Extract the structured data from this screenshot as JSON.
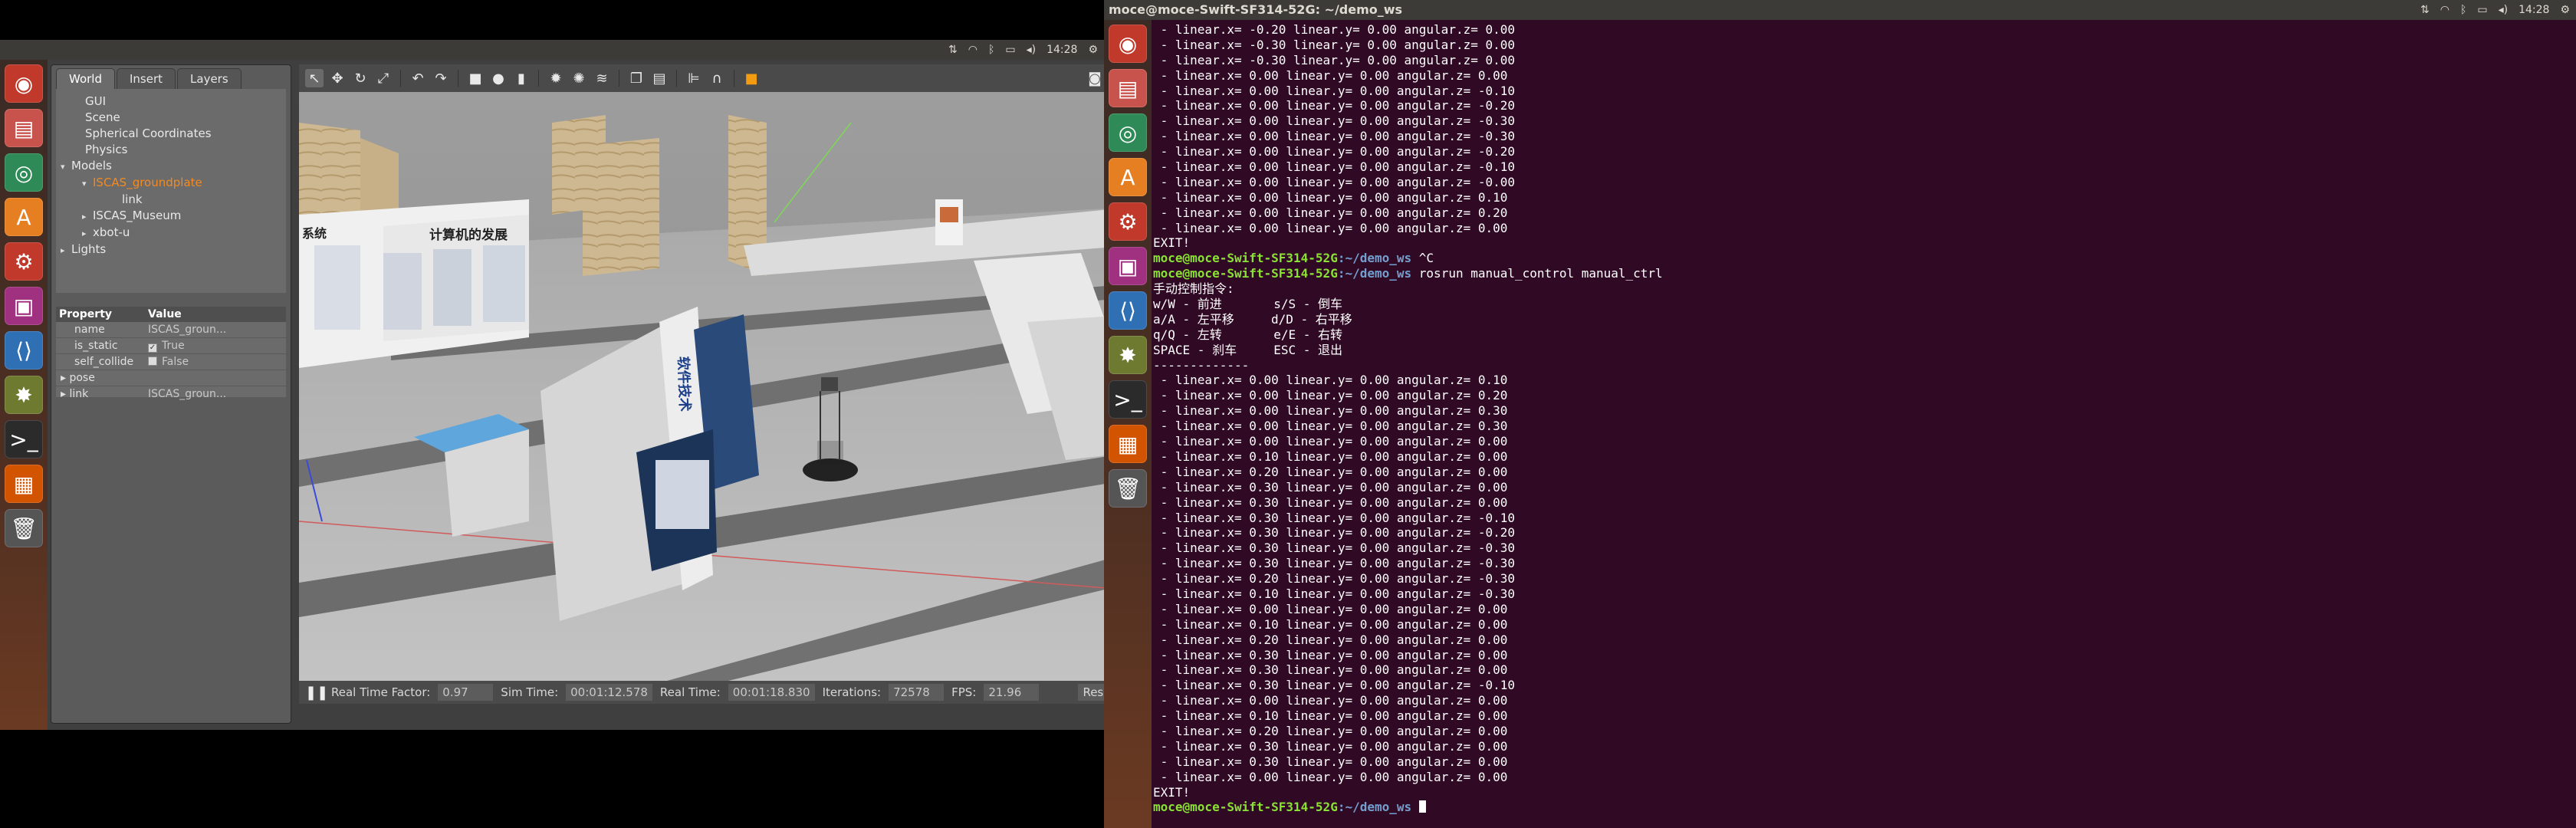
{
  "left": {
    "topbar": {
      "clock": "14:28"
    },
    "launcher": [
      {
        "name": "dash-icon",
        "glyph": "◉",
        "color": "#c0392b"
      },
      {
        "name": "files-icon",
        "glyph": "▤",
        "color": "#c8524c"
      },
      {
        "name": "chrome-icon",
        "glyph": "◎",
        "color": "#2e8b57"
      },
      {
        "name": "software-center-icon",
        "glyph": "A",
        "color": "#e67e22"
      },
      {
        "name": "settings-icon",
        "glyph": "⚙",
        "color": "#c0392b"
      },
      {
        "name": "media-icon",
        "glyph": "▣",
        "color": "#a03080"
      },
      {
        "name": "vscode-icon",
        "glyph": "⟨⟩",
        "color": "#2f6fb3"
      },
      {
        "name": "gazebo-icon",
        "glyph": "✸",
        "color": "#6e7a2f"
      },
      {
        "name": "terminal-icon",
        "glyph": ">_",
        "color": "#2b2b2b"
      },
      {
        "name": "package-icon",
        "glyph": "▦",
        "color": "#d35400"
      },
      {
        "name": "trash-icon",
        "glyph": "🗑",
        "color": "#555555"
      }
    ],
    "gazebo": {
      "tabs": [
        "World",
        "Insert",
        "Layers"
      ],
      "tree": [
        {
          "label": "GUI",
          "level": 1,
          "arrow": ""
        },
        {
          "label": "Scene",
          "level": 1,
          "arrow": ""
        },
        {
          "label": "Spherical Coordinates",
          "level": 1,
          "arrow": ""
        },
        {
          "label": "Physics",
          "level": 1,
          "arrow": ""
        },
        {
          "label": "Models",
          "level": 0,
          "arrow": "▾"
        },
        {
          "label": "ISCAS_groundplate",
          "level": 2,
          "arrow": "▾",
          "selected": true
        },
        {
          "label": "link",
          "level": 3,
          "arrow": ""
        },
        {
          "label": "ISCAS_Museum",
          "level": 2,
          "arrow": "▸"
        },
        {
          "label": "xbot-u",
          "level": 2,
          "arrow": "▸"
        },
        {
          "label": "Lights",
          "level": 0,
          "arrow": "▸"
        }
      ],
      "props_header": {
        "col1": "Property",
        "col2": "Value"
      },
      "props": [
        {
          "name": "name",
          "value": "ISCAS_groun...",
          "checkbox": false,
          "arrow": ""
        },
        {
          "name": "is_static",
          "value": "True",
          "checkbox": true,
          "checked": true,
          "arrow": ""
        },
        {
          "name": "self_collide",
          "value": "False",
          "checkbox": true,
          "checked": false,
          "arrow": ""
        },
        {
          "name": "pose",
          "value": "",
          "checkbox": false,
          "arrow": "▸"
        },
        {
          "name": "link",
          "value": "ISCAS_groun...",
          "checkbox": false,
          "arrow": "▸"
        }
      ],
      "bottombar": {
        "rtf_label": "Real Time Factor:",
        "rtf_value": "0.97",
        "sim_label": "Sim Time:",
        "sim_value": "00:01:12.578",
        "real_label": "Real Time:",
        "real_value": "00:01:18.830",
        "iter_label": "Iterations:",
        "iter_value": "72578",
        "fps_label": "FPS:",
        "fps_value": "21.96",
        "reset_label": "Reset Ti"
      },
      "scene": {
        "sign_left": "系统",
        "sign_mid": "计算机的发展",
        "sign_stand": "软件技术"
      }
    }
  },
  "right": {
    "title": "moce@moce-Swift-SF314-52G: ~/demo_ws",
    "clock": "14:28",
    "prompt_user": "moce@moce-Swift-SF314-52G",
    "prompt_path": ":~/demo_ws",
    "lines": [
      " - linear.x= -0.20 linear.y= 0.00 angular.z= 0.00",
      " - linear.x= -0.30 linear.y= 0.00 angular.z= 0.00",
      " - linear.x= -0.30 linear.y= 0.00 angular.z= 0.00",
      " - linear.x= 0.00 linear.y= 0.00 angular.z= 0.00",
      " - linear.x= 0.00 linear.y= 0.00 angular.z= -0.10",
      " - linear.x= 0.00 linear.y= 0.00 angular.z= -0.20",
      " - linear.x= 0.00 linear.y= 0.00 angular.z= -0.30",
      " - linear.x= 0.00 linear.y= 0.00 angular.z= -0.30",
      " - linear.x= 0.00 linear.y= 0.00 angular.z= -0.20",
      " - linear.x= 0.00 linear.y= 0.00 angular.z= -0.10",
      " - linear.x= 0.00 linear.y= 0.00 angular.z= -0.00",
      " - linear.x= 0.00 linear.y= 0.00 angular.z= 0.10",
      " - linear.x= 0.00 linear.y= 0.00 angular.z= 0.20",
      " - linear.x= 0.00 linear.y= 0.00 angular.z= 0.00",
      "EXIT!",
      "$P$ ^C",
      "$P$ rosrun manual_control manual_ctrl",
      "手动控制指令:",
      "w/W - 前进       s/S - 倒车",
      "a/A - 左平移     d/D - 右平移",
      "q/Q - 左转       e/E - 右转",
      "SPACE - 刹车     ESC - 退出",
      "-------------",
      " - linear.x= 0.00 linear.y= 0.00 angular.z= 0.10",
      " - linear.x= 0.00 linear.y= 0.00 angular.z= 0.20",
      " - linear.x= 0.00 linear.y= 0.00 angular.z= 0.30",
      " - linear.x= 0.00 linear.y= 0.00 angular.z= 0.30",
      " - linear.x= 0.00 linear.y= 0.00 angular.z= 0.00",
      " - linear.x= 0.10 linear.y= 0.00 angular.z= 0.00",
      " - linear.x= 0.20 linear.y= 0.00 angular.z= 0.00",
      " - linear.x= 0.30 linear.y= 0.00 angular.z= 0.00",
      " - linear.x= 0.30 linear.y= 0.00 angular.z= 0.00",
      " - linear.x= 0.30 linear.y= 0.00 angular.z= -0.10",
      " - linear.x= 0.30 linear.y= 0.00 angular.z= -0.20",
      " - linear.x= 0.30 linear.y= 0.00 angular.z= -0.30",
      " - linear.x= 0.30 linear.y= 0.00 angular.z= -0.30",
      " - linear.x= 0.20 linear.y= 0.00 angular.z= -0.30",
      " - linear.x= 0.10 linear.y= 0.00 angular.z= -0.30",
      " - linear.x= 0.00 linear.y= 0.00 angular.z= 0.00",
      " - linear.x= 0.10 linear.y= 0.00 angular.z= 0.00",
      " - linear.x= 0.20 linear.y= 0.00 angular.z= 0.00",
      " - linear.x= 0.30 linear.y= 0.00 angular.z= 0.00",
      " - linear.x= 0.30 linear.y= 0.00 angular.z= 0.00",
      " - linear.x= 0.30 linear.y= 0.00 angular.z= -0.10",
      " - linear.x= 0.00 linear.y= 0.00 angular.z= 0.00",
      " - linear.x= 0.10 linear.y= 0.00 angular.z= 0.00",
      " - linear.x= 0.20 linear.y= 0.00 angular.z= 0.00",
      " - linear.x= 0.30 linear.y= 0.00 angular.z= 0.00",
      " - linear.x= 0.30 linear.y= 0.00 angular.z= 0.00",
      " - linear.x= 0.00 linear.y= 0.00 angular.z= 0.00",
      "EXIT!",
      "$P$ $CURSOR$"
    ],
    "launcher": [
      {
        "name": "dash-icon",
        "glyph": "◉",
        "color": "#c0392b"
      },
      {
        "name": "files-icon",
        "glyph": "▤",
        "color": "#c8524c"
      },
      {
        "name": "chrome-icon",
        "glyph": "◎",
        "color": "#2e8b57"
      },
      {
        "name": "software-center-icon",
        "glyph": "A",
        "color": "#e67e22"
      },
      {
        "name": "settings-icon",
        "glyph": "⚙",
        "color": "#c0392b"
      },
      {
        "name": "media-icon",
        "glyph": "▣",
        "color": "#a03080"
      },
      {
        "name": "vscode-icon",
        "glyph": "⟨⟩",
        "color": "#2f6fb3"
      },
      {
        "name": "gazebo-icon",
        "glyph": "✸",
        "color": "#6e7a2f"
      },
      {
        "name": "terminal-icon",
        "glyph": ">_",
        "color": "#2b2b2b"
      },
      {
        "name": "package-icon",
        "glyph": "▦",
        "color": "#d35400"
      },
      {
        "name": "trash-icon",
        "glyph": "🗑",
        "color": "#555555"
      }
    ]
  }
}
